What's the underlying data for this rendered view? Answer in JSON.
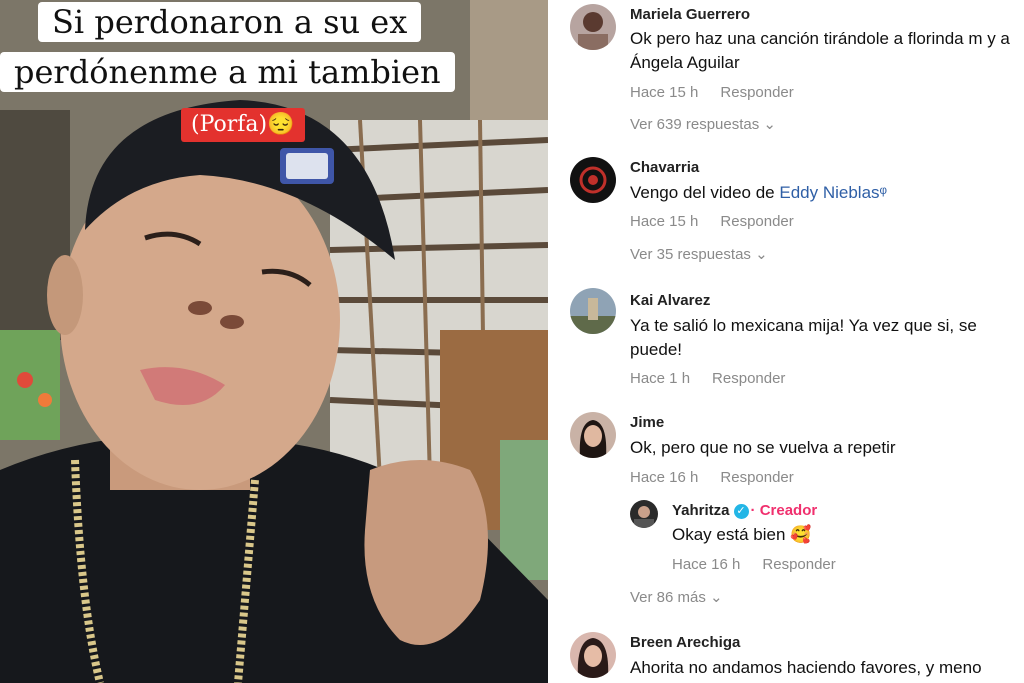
{
  "video": {
    "caption_line1": "Si perdonaron a su ex",
    "caption_line2": "perdónenme a mi tambien",
    "badge": "(Porfa)😔"
  },
  "comments": [
    {
      "user": "Mariela Guerrero",
      "text": "Ok pero haz una canción tirándole a florinda m y a Ángela Aguilar",
      "time": "Hace 15 h",
      "reply_label": "Responder",
      "view_replies": "Ver 639 respuestas ⌄"
    },
    {
      "user": "Chavarria",
      "text_prefix": "Vengo del video de ",
      "link": "Eddy Nieblas",
      "link_icon": "ᵠ",
      "time": "Hace 15 h",
      "reply_label": "Responder",
      "view_replies": "Ver 35 respuestas ⌄"
    },
    {
      "user": "Kai Alvarez",
      "text": "Ya te salió lo mexicana mija! Ya vez que si, se puede!",
      "time": "Hace 1 h",
      "reply_label": "Responder"
    },
    {
      "user": "Jime",
      "text": "Ok, pero que no se vuelva a repetir",
      "time": "Hace 16 h",
      "reply_label": "Responder",
      "reply": {
        "user": "Yahritza",
        "verified_icon": "✓",
        "creator_label": "· Creador",
        "text": "Okay está bien 🥰",
        "time": "Hace 16 h",
        "reply_label": "Responder"
      },
      "view_more": "Ver 86 más ⌄"
    },
    {
      "user": "Breen Arechiga",
      "text": "Ahorita no andamos haciendo favores, y meno"
    }
  ]
}
